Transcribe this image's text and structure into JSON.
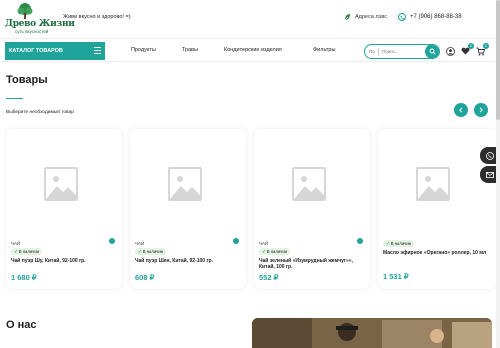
{
  "header": {
    "logo_name": "Древо Жизни",
    "logo_sub": "суть вкусностей",
    "slogan": "Живи вкусно и здорово! =)",
    "address": "Адреса лэвс",
    "phone": "+7 (906) 868-88-38"
  },
  "nav": {
    "catalog_label": "Каталог товаров",
    "items": [
      {
        "label": "Продукты"
      },
      {
        "label": "Травы"
      },
      {
        "label": "Кондитерские изделия"
      },
      {
        "label": "Фильтры"
      }
    ],
    "search_select": "По",
    "search_placeholder": "Поиск...",
    "wishlist_count": "0",
    "cart_count": "0"
  },
  "products_section": {
    "title": "Товары",
    "subtitle": "Выберите необходимый товар",
    "cards": [
      {
        "category": "ЧАЙ",
        "stock": "В наличии",
        "name": "Чай пуэр Шу, Китай, 92-100 гр.",
        "price": "1 680 ₽"
      },
      {
        "category": "ЧАЙ",
        "stock": "В наличии",
        "name": "Чай пуэр Шен, Китай, 92-100 гр.",
        "price": "608 ₽"
      },
      {
        "category": "ЧАЙ",
        "stock": "В наличии",
        "name": "Чай зеленый «Изумрудный жемчуг»», Китай, 100 гр.",
        "price": "552 ₽"
      },
      {
        "category": "",
        "stock": "В наличии",
        "name": "Масло эфирное «Орегано» роллер, 10 мл",
        "price": "1 531 ₽"
      }
    ]
  },
  "about": {
    "title": "О нас"
  },
  "colors": {
    "accent": "#1fa39a",
    "brand_green": "#1a6b3c",
    "stock_bg": "#e3f4e5"
  }
}
